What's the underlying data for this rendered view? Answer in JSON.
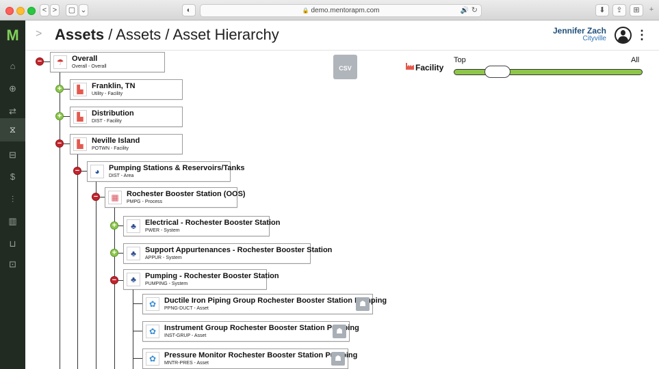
{
  "browser": {
    "url": "demo.mentorapm.com",
    "nav_back": "<",
    "nav_forward": ">",
    "sidebar_btn": "▢",
    "dropdown": "⌄",
    "shield": "◐",
    "lock_icon": "🔒",
    "speaker_icon": "🔊",
    "reload_icon": "↻",
    "download_icon": "⬇",
    "share_icon": "⇪",
    "tabs_icon": "⊞",
    "new_tab": "+"
  },
  "app": {
    "logo": "M",
    "chevron": ">",
    "title_bold": "Assets",
    "title_sep1": " / ",
    "title_part2": "Assets",
    "title_sep2": " / ",
    "title_part3": "Asset Hierarchy",
    "user_name": "Jennifer Zach",
    "user_city": "Cityville",
    "menu_icon": "⋮"
  },
  "sidebar": {
    "items": [
      {
        "icon": "⌂",
        "name": "home-icon"
      },
      {
        "icon": "⊕",
        "name": "globe-icon"
      },
      {
        "icon": "⇄",
        "name": "transfer-icon"
      },
      {
        "icon": "⧖",
        "name": "hierarchy-icon"
      },
      {
        "icon": "⊟",
        "name": "briefcase-icon"
      },
      {
        "icon": "$",
        "name": "dollar-icon"
      },
      {
        "icon": "⫶",
        "name": "analytics-icon"
      },
      {
        "icon": "▥",
        "name": "report-icon"
      },
      {
        "icon": "⊔",
        "name": "chart-icon"
      },
      {
        "icon": "⊡",
        "name": "archive-icon"
      }
    ]
  },
  "toolbar": {
    "csv_label": "CSV",
    "facility_label": "Facility",
    "level_top": "Top",
    "level_all": "All",
    "level_slider_value": 0.25
  },
  "tree": [
    {
      "name": "Overall",
      "code": "Overall - Overall",
      "icon_name": "umbrella-icon",
      "icon": "☂",
      "icon_color": "#d23a3a",
      "toggle": "minus"
    },
    {
      "name": "Franklin, TN",
      "code": "Utility - Facility",
      "icon_name": "factory-icon",
      "icon": "▙",
      "icon_color": "#e45a4e",
      "toggle": "plus"
    },
    {
      "name": "Distribution",
      "code": "DIST - Facility",
      "icon_name": "factory-icon",
      "icon": "▙",
      "icon_color": "#e45a4e",
      "toggle": "plus"
    },
    {
      "name": "Neville Island",
      "code": "POTWN - Facility",
      "icon_name": "factory-icon",
      "icon": "▙",
      "icon_color": "#e45a4e",
      "toggle": "minus"
    },
    {
      "name": "Pumping Stations & Reservoirs/Tanks",
      "code": "DIST - Area",
      "icon_name": "area-icon",
      "icon": "◕",
      "icon_color": "#1e4f9a",
      "toggle": "minus"
    },
    {
      "name": "Rochester Booster Station (OOS)",
      "code": "PMPG - Process",
      "icon_name": "process-icon",
      "icon": "▦",
      "icon_color": "#d9535f",
      "toggle": "minus"
    },
    {
      "name": "Electrical - Rochester Booster Station",
      "code": "PWER - System",
      "icon_name": "system-icon",
      "icon": "♣",
      "icon_color": "#2c4f8f",
      "toggle": "plus"
    },
    {
      "name": "Support Appurtenances - Rochester Booster Station",
      "code": "APPUR - System",
      "icon_name": "system-icon",
      "icon": "♣",
      "icon_color": "#2c4f8f",
      "toggle": "plus"
    },
    {
      "name": "Pumping - Rochester Booster Station",
      "code": "PUMPING - System",
      "icon_name": "system-icon",
      "icon": "♣",
      "icon_color": "#2c4f8f",
      "toggle": "minus"
    },
    {
      "name": "Ductile Iron Piping Group Rochester Booster Station Pumping",
      "code": "PPNG-DUCT - Asset",
      "icon_name": "asset-icon",
      "icon": "✿",
      "icon_color": "#3a8fd6",
      "action_icon": "☗"
    },
    {
      "name": "Instrument Group Rochester Booster Station Pumping",
      "code": "INST-GRUP - Asset",
      "icon_name": "asset-icon",
      "icon": "✿",
      "icon_color": "#3a8fd6",
      "action_icon": "☗"
    },
    {
      "name": "Pressure Monitor Rochester Booster Station Pumping",
      "code": "MNTR-PRES - Asset",
      "icon_name": "asset-icon",
      "icon": "✿",
      "icon_color": "#3a8fd6",
      "action_icon": "☗"
    }
  ]
}
